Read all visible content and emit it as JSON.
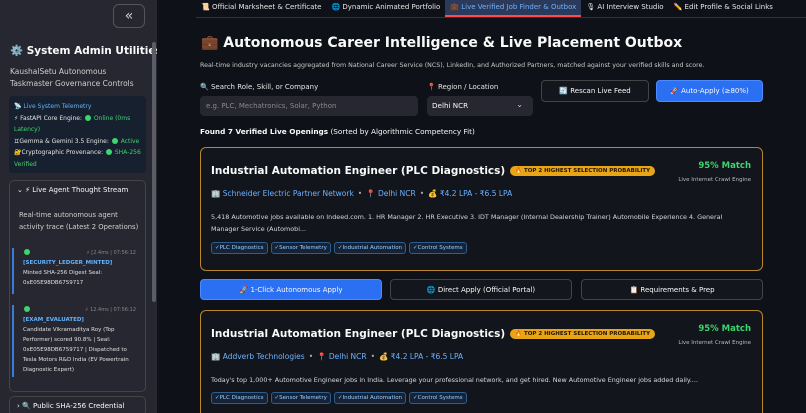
{
  "sidebar": {
    "collapse_label": "«",
    "title": "⚙️ System Admin Utilities",
    "subtitle": "KaushalSetu Autonomous Taskmaster Governance Controls",
    "telemetry": {
      "title": "📡 Live System Telemetry",
      "fastapi_label": "⚡ FastAPI Core Engine:",
      "fastapi_status": "Online (0ms Latency)",
      "gemma_label": "♊Gemma & Gemini 3.5 Engine:",
      "gemma_status": "Active",
      "crypto_label": "🔐Cryptographic Provenance:",
      "crypto_status": "SHA-256 Verified"
    },
    "agent": {
      "header": "⌄  ⚡ Live Agent Thought Stream",
      "desc": "Real-time autonomous agent activity trace (Latest 2 Operations)",
      "logs": [
        {
          "tag": "[SECURITY_LEDGER_MINTED]",
          "time": "⚡ [2.4ms | 07:56:12",
          "text": "Minted SHA-256 Digest Seal: 0xE05E98DB6759717"
        },
        {
          "tag": "[EXAM_EVALUATED]",
          "time": "⚡ 12.4ms | 07:56:12",
          "text": "Candidate Vikramaditya Roy (Top Performer) scored 90.8% | Seal: 0xE05E98DB6759717 | Dispatched to Tesla Motors R&D India (EV Powertrain Diagnostic Expert)"
        }
      ]
    },
    "credential": "›  🔍 Public SHA-256 Credential"
  },
  "tabs": [
    {
      "label": "📜 Official Marksheet & Certificate",
      "active": false
    },
    {
      "label": "🌐 Dynamic Animated Portfolio",
      "active": false
    },
    {
      "label": "💼 Live Verified Job Finder & Outbox",
      "active": true
    },
    {
      "label": "🎙 AI Interview Studio",
      "active": false
    },
    {
      "label": "✏️ Edit Profile & Social Links",
      "active": false
    }
  ],
  "main": {
    "title": "💼 Autonomous Career Intelligence & Live Placement Outbox",
    "desc": "Real-time industry vacancies aggregated from National Career Service (NCS), LinkedIn, and Authorized Partners, matched against your verified skills and score.",
    "search_label": "🔍 Search Role, Skill, or Company",
    "search_placeholder": "e.g. PLC, Mechatronics, Solar, Python",
    "region_label": "📍 Region / Location",
    "region_value": "Delhi NCR",
    "rescan": "🔄 Rescan Live Feed",
    "autoapply": "🚀 Auto-Apply (≥80%)",
    "found_bold": "Found 7 Verified Live Openings",
    "found_rest": " (Sorted by Algorithmic Competency Fit)"
  },
  "cards": [
    {
      "title": "Industrial Automation Engineer (PLC Diagnostics)",
      "badge": "🔥 TOP 2 HIGHEST SELECTION PROBABILITY",
      "match": "95% Match",
      "crawl": "Live Internet Crawl Engine",
      "company": "🏢 Schneider Electric Partner Network",
      "location": "📍 Delhi NCR",
      "salary": "💰 ₹4.2 LPA - ₹6.5 LPA",
      "desc": "5,418 Automotive jobs available on Indeed.com. 1. HR Manager 2. HR Executive 3. IDT Manager (Internal Dealership Trainer) Automobile Experience 4. General Manager Service (Automobi...",
      "tags": [
        "✓PLC Diagnostics",
        "✓Sensor Telemetry",
        "✓Industrial Automation",
        "✓Control Systems"
      ]
    },
    {
      "title": "Industrial Automation Engineer (PLC Diagnostics)",
      "badge": "🔥 TOP 2 HIGHEST SELECTION PROBABILITY",
      "match": "95% Match",
      "crawl": "Live Internet Crawl Engine",
      "company": "🏢 Addverb Technologies",
      "location": "📍 Delhi NCR",
      "salary": "💰 ₹4.2 LPA - ₹6.5 LPA",
      "desc": "Today's top 1,000+ Automotive Engineer jobs in India. Leverage your professional network, and get hired. New Automotive Engineer jobs added daily....",
      "tags": [
        "✓PLC Diagnostics",
        "✓Sensor Telemetry",
        "✓Industrial Automation",
        "✓Control Systems"
      ]
    }
  ],
  "actions": {
    "one_click": "🚀 1-Click Autonomous Apply",
    "direct": "🌐 Direct Apply (Official Portal)",
    "requirements": "📋 Requirements & Prep"
  },
  "colors": {
    "background": "#0e1117",
    "sidebar": "#262730",
    "primary_blue": "#2b6ff2",
    "match_green": "#3dd56d",
    "badge_gold": "#e8a516",
    "card_border": "#b8862c"
  }
}
